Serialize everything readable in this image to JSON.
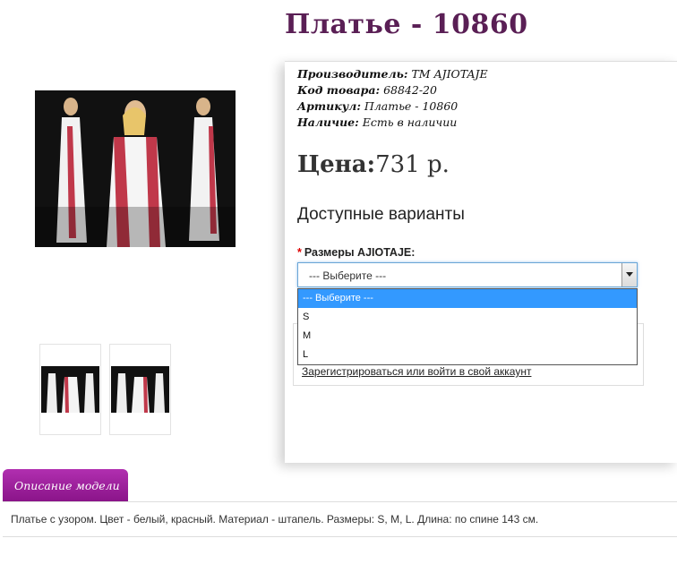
{
  "product": {
    "title": "Платье - 10860",
    "specs": [
      {
        "label": "Производитель:",
        "value": "ТМ AJIOTAJE"
      },
      {
        "label": "Код товара:",
        "value": "68842-20"
      },
      {
        "label": "Артикул:",
        "value": "Платье - 10860"
      },
      {
        "label": "Наличие:",
        "value": "Есть в наличии"
      }
    ],
    "price_label": "Цена:",
    "price_value": "731 р."
  },
  "variants": {
    "title": "Доступные варианты",
    "required_mark": "*",
    "size_label": "Размеры AJIOTAJE:",
    "select_value": "--- Выберите ---",
    "options": [
      "--- Выберите ---",
      "S",
      "M",
      "L"
    ]
  },
  "login": {
    "link_text": "Зарегистрироваться или войти в свой аккаунт"
  },
  "description": {
    "tab_label": "Описание модели",
    "text": "Платье с узором. Цвет - белый, красный. Материал - штапель. Размеры: S, M, L. Длина: по спине 143 см."
  },
  "colors": {
    "title": "#5a1f55",
    "tab": "#9c1f9b",
    "dropdown_highlight": "#3399ff"
  }
}
